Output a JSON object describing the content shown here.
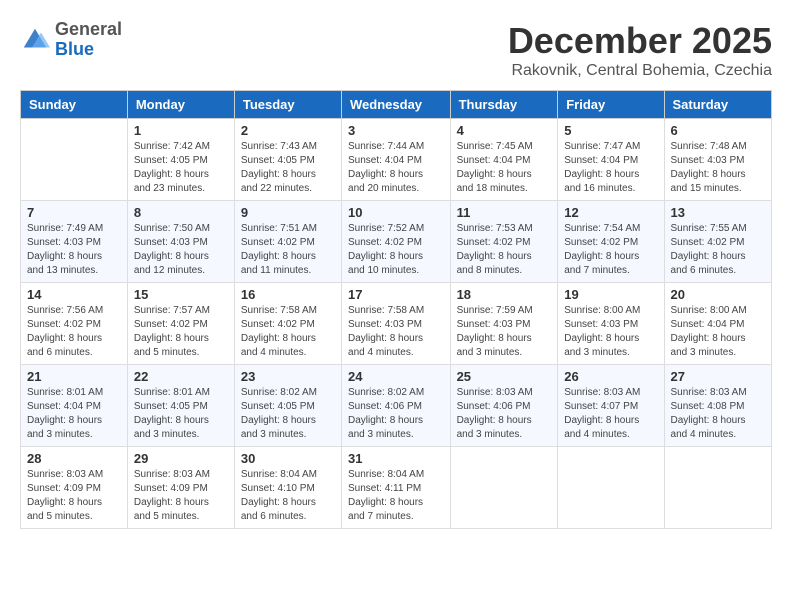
{
  "header": {
    "logo": {
      "line1": "General",
      "line2": "Blue"
    },
    "title": "December 2025",
    "subtitle": "Rakovnik, Central Bohemia, Czechia"
  },
  "days_of_week": [
    "Sunday",
    "Monday",
    "Tuesday",
    "Wednesday",
    "Thursday",
    "Friday",
    "Saturday"
  ],
  "weeks": [
    [
      {
        "day": "",
        "info": ""
      },
      {
        "day": "1",
        "info": "Sunrise: 7:42 AM\nSunset: 4:05 PM\nDaylight: 8 hours\nand 23 minutes."
      },
      {
        "day": "2",
        "info": "Sunrise: 7:43 AM\nSunset: 4:05 PM\nDaylight: 8 hours\nand 22 minutes."
      },
      {
        "day": "3",
        "info": "Sunrise: 7:44 AM\nSunset: 4:04 PM\nDaylight: 8 hours\nand 20 minutes."
      },
      {
        "day": "4",
        "info": "Sunrise: 7:45 AM\nSunset: 4:04 PM\nDaylight: 8 hours\nand 18 minutes."
      },
      {
        "day": "5",
        "info": "Sunrise: 7:47 AM\nSunset: 4:04 PM\nDaylight: 8 hours\nand 16 minutes."
      },
      {
        "day": "6",
        "info": "Sunrise: 7:48 AM\nSunset: 4:03 PM\nDaylight: 8 hours\nand 15 minutes."
      }
    ],
    [
      {
        "day": "7",
        "info": "Sunrise: 7:49 AM\nSunset: 4:03 PM\nDaylight: 8 hours\nand 13 minutes."
      },
      {
        "day": "8",
        "info": "Sunrise: 7:50 AM\nSunset: 4:03 PM\nDaylight: 8 hours\nand 12 minutes."
      },
      {
        "day": "9",
        "info": "Sunrise: 7:51 AM\nSunset: 4:02 PM\nDaylight: 8 hours\nand 11 minutes."
      },
      {
        "day": "10",
        "info": "Sunrise: 7:52 AM\nSunset: 4:02 PM\nDaylight: 8 hours\nand 10 minutes."
      },
      {
        "day": "11",
        "info": "Sunrise: 7:53 AM\nSunset: 4:02 PM\nDaylight: 8 hours\nand 8 minutes."
      },
      {
        "day": "12",
        "info": "Sunrise: 7:54 AM\nSunset: 4:02 PM\nDaylight: 8 hours\nand 7 minutes."
      },
      {
        "day": "13",
        "info": "Sunrise: 7:55 AM\nSunset: 4:02 PM\nDaylight: 8 hours\nand 6 minutes."
      }
    ],
    [
      {
        "day": "14",
        "info": "Sunrise: 7:56 AM\nSunset: 4:02 PM\nDaylight: 8 hours\nand 6 minutes."
      },
      {
        "day": "15",
        "info": "Sunrise: 7:57 AM\nSunset: 4:02 PM\nDaylight: 8 hours\nand 5 minutes."
      },
      {
        "day": "16",
        "info": "Sunrise: 7:58 AM\nSunset: 4:02 PM\nDaylight: 8 hours\nand 4 minutes."
      },
      {
        "day": "17",
        "info": "Sunrise: 7:58 AM\nSunset: 4:03 PM\nDaylight: 8 hours\nand 4 minutes."
      },
      {
        "day": "18",
        "info": "Sunrise: 7:59 AM\nSunset: 4:03 PM\nDaylight: 8 hours\nand 3 minutes."
      },
      {
        "day": "19",
        "info": "Sunrise: 8:00 AM\nSunset: 4:03 PM\nDaylight: 8 hours\nand 3 minutes."
      },
      {
        "day": "20",
        "info": "Sunrise: 8:00 AM\nSunset: 4:04 PM\nDaylight: 8 hours\nand 3 minutes."
      }
    ],
    [
      {
        "day": "21",
        "info": "Sunrise: 8:01 AM\nSunset: 4:04 PM\nDaylight: 8 hours\nand 3 minutes."
      },
      {
        "day": "22",
        "info": "Sunrise: 8:01 AM\nSunset: 4:05 PM\nDaylight: 8 hours\nand 3 minutes."
      },
      {
        "day": "23",
        "info": "Sunrise: 8:02 AM\nSunset: 4:05 PM\nDaylight: 8 hours\nand 3 minutes."
      },
      {
        "day": "24",
        "info": "Sunrise: 8:02 AM\nSunset: 4:06 PM\nDaylight: 8 hours\nand 3 minutes."
      },
      {
        "day": "25",
        "info": "Sunrise: 8:03 AM\nSunset: 4:06 PM\nDaylight: 8 hours\nand 3 minutes."
      },
      {
        "day": "26",
        "info": "Sunrise: 8:03 AM\nSunset: 4:07 PM\nDaylight: 8 hours\nand 4 minutes."
      },
      {
        "day": "27",
        "info": "Sunrise: 8:03 AM\nSunset: 4:08 PM\nDaylight: 8 hours\nand 4 minutes."
      }
    ],
    [
      {
        "day": "28",
        "info": "Sunrise: 8:03 AM\nSunset: 4:09 PM\nDaylight: 8 hours\nand 5 minutes."
      },
      {
        "day": "29",
        "info": "Sunrise: 8:03 AM\nSunset: 4:09 PM\nDaylight: 8 hours\nand 5 minutes."
      },
      {
        "day": "30",
        "info": "Sunrise: 8:04 AM\nSunset: 4:10 PM\nDaylight: 8 hours\nand 6 minutes."
      },
      {
        "day": "31",
        "info": "Sunrise: 8:04 AM\nSunset: 4:11 PM\nDaylight: 8 hours\nand 7 minutes."
      },
      {
        "day": "",
        "info": ""
      },
      {
        "day": "",
        "info": ""
      },
      {
        "day": "",
        "info": ""
      }
    ]
  ]
}
